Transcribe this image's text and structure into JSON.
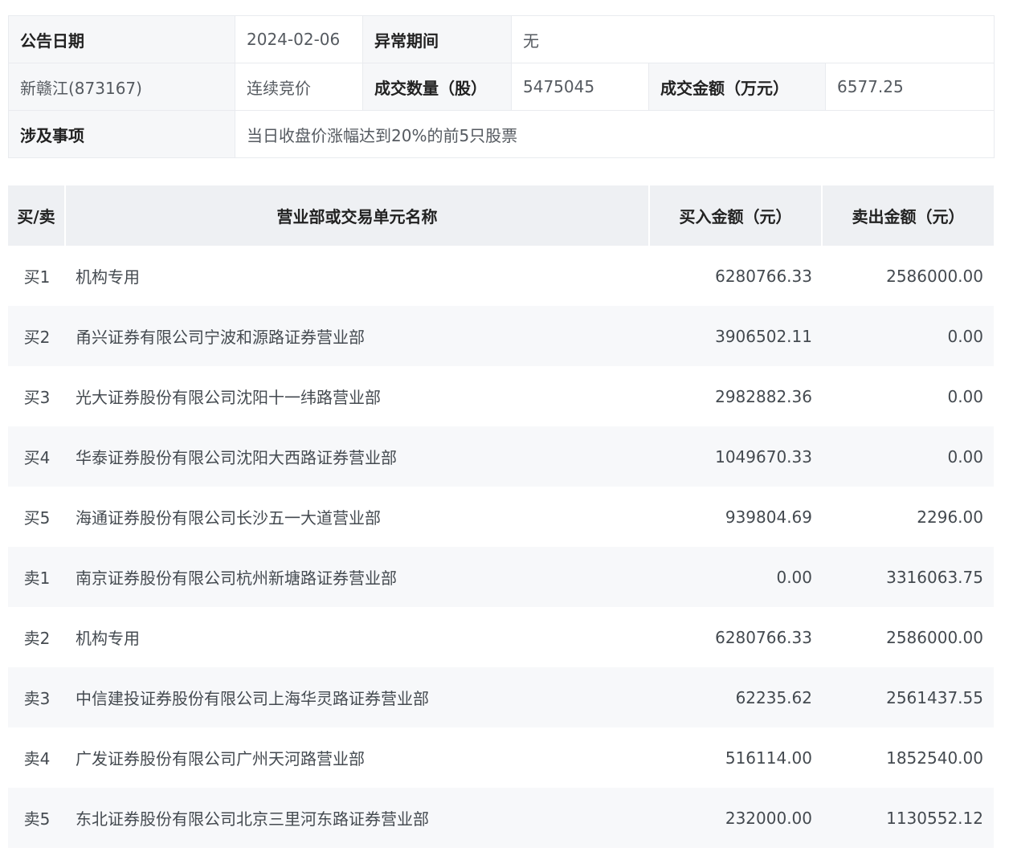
{
  "summary": {
    "date_label": "公告日期",
    "date_value": "2024-02-06",
    "abnormal_label": "异常期间",
    "abnormal_value": "无",
    "stock": "新赣江(873167)",
    "trade_method": "连续竞价",
    "volume_label": "成交数量（股）",
    "volume_value": "5475045",
    "amount_label": "成交金额（万元）",
    "amount_value": "6577.25",
    "matter_label": "涉及事项",
    "matter_value": "当日收盘价涨幅达到20%的前5只股票"
  },
  "table": {
    "headers": [
      "买/卖",
      "营业部或交易单元名称",
      "买入金额（元）",
      "卖出金额（元）"
    ],
    "rows": [
      {
        "side": "买1",
        "name": "机构专用",
        "buy": "6280766.33",
        "sell": "2586000.00"
      },
      {
        "side": "买2",
        "name": "甬兴证券有限公司宁波和源路证券营业部",
        "buy": "3906502.11",
        "sell": "0.00"
      },
      {
        "side": "买3",
        "name": "光大证券股份有限公司沈阳十一纬路营业部",
        "buy": "2982882.36",
        "sell": "0.00"
      },
      {
        "side": "买4",
        "name": "华泰证券股份有限公司沈阳大西路证券营业部",
        "buy": "1049670.33",
        "sell": "0.00"
      },
      {
        "side": "买5",
        "name": "海通证券股份有限公司长沙五一大道营业部",
        "buy": "939804.69",
        "sell": "2296.00"
      },
      {
        "side": "卖1",
        "name": "南京证券股份有限公司杭州新塘路证券营业部",
        "buy": "0.00",
        "sell": "3316063.75"
      },
      {
        "side": "卖2",
        "name": "机构专用",
        "buy": "6280766.33",
        "sell": "2586000.00"
      },
      {
        "side": "卖3",
        "name": "中信建投证券股份有限公司上海华灵路证券营业部",
        "buy": "62235.62",
        "sell": "2561437.55"
      },
      {
        "side": "卖4",
        "name": "广发证券股份有限公司广州天河路营业部",
        "buy": "516114.00",
        "sell": "1852540.00"
      },
      {
        "side": "卖5",
        "name": "东北证券股份有限公司北京三里河东路证券营业部",
        "buy": "232000.00",
        "sell": "1130552.12"
      }
    ]
  }
}
